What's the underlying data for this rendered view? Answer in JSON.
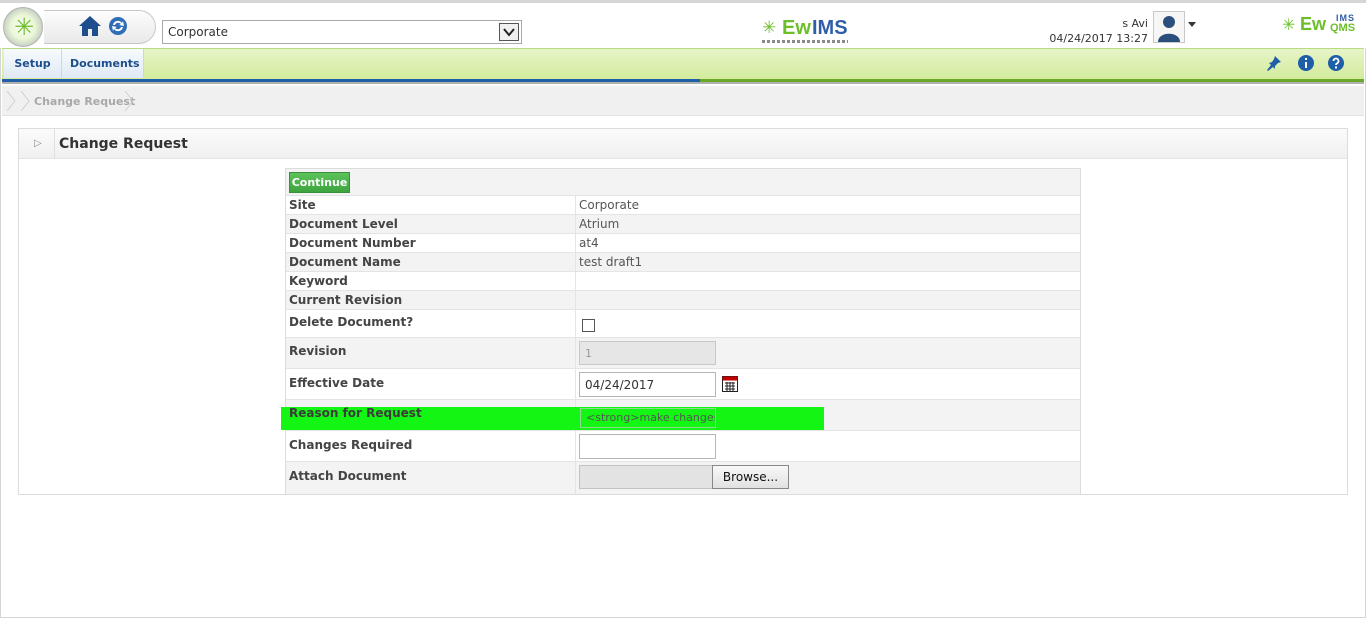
{
  "header": {
    "site_select": {
      "value": "Corporate"
    },
    "brand_center": {
      "ew": "Ew",
      "ims": "IMS"
    },
    "user": {
      "name": "s Avi",
      "datetime": "04/24/2017 13:27"
    },
    "brand_right": {
      "ew": "Ew",
      "ims": "IMS",
      "qms": "QMS"
    },
    "colors": {
      "brand_green": "#6cbf2a",
      "brand_blue": "#2f5ea8"
    }
  },
  "nav": {
    "items": [
      {
        "label": "Setup"
      },
      {
        "label": "Documents"
      }
    ],
    "right_icons": [
      "pin-icon",
      "info-icon",
      "help-icon"
    ]
  },
  "breadcrumb": {
    "current": "Change Request"
  },
  "panel": {
    "title": "Change Request"
  },
  "form": {
    "continue_label": "Continue",
    "rows": [
      {
        "label": "Site",
        "value": "Corporate"
      },
      {
        "label": "Document Level",
        "value": "Atrium"
      },
      {
        "label": "Document Number",
        "value": "at4"
      },
      {
        "label": "Document Name",
        "value": "test draft1"
      },
      {
        "label": "Keyword",
        "value": ""
      },
      {
        "label": "Current Revision",
        "value": ""
      }
    ],
    "delete_label": "Delete Document?",
    "delete_checked": false,
    "revision_label": "Revision",
    "revision_value": "1",
    "effective_label": "Effective Date",
    "effective_value": "04/24/2017",
    "reason_label": "Reason for Request",
    "reason_value": "<strong>make changes</strong>",
    "changes_label": "Changes Required",
    "changes_value": "",
    "attach_label": "Attach Document",
    "browse_label": "Browse...",
    "highlight_color": "#13f613"
  }
}
